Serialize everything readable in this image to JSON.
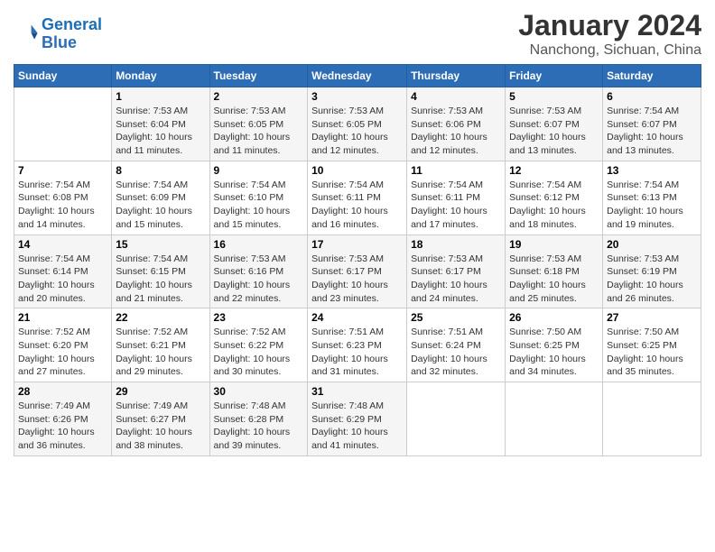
{
  "logo": {
    "line1": "General",
    "line2": "Blue"
  },
  "title": "January 2024",
  "subtitle": "Nanchong, Sichuan, China",
  "weekdays": [
    "Sunday",
    "Monday",
    "Tuesday",
    "Wednesday",
    "Thursday",
    "Friday",
    "Saturday"
  ],
  "weeks": [
    [
      {
        "day": "",
        "sunrise": "",
        "sunset": "",
        "daylight": ""
      },
      {
        "day": "1",
        "sunrise": "Sunrise: 7:53 AM",
        "sunset": "Sunset: 6:04 PM",
        "daylight": "Daylight: 10 hours and 11 minutes."
      },
      {
        "day": "2",
        "sunrise": "Sunrise: 7:53 AM",
        "sunset": "Sunset: 6:05 PM",
        "daylight": "Daylight: 10 hours and 11 minutes."
      },
      {
        "day": "3",
        "sunrise": "Sunrise: 7:53 AM",
        "sunset": "Sunset: 6:05 PM",
        "daylight": "Daylight: 10 hours and 12 minutes."
      },
      {
        "day": "4",
        "sunrise": "Sunrise: 7:53 AM",
        "sunset": "Sunset: 6:06 PM",
        "daylight": "Daylight: 10 hours and 12 minutes."
      },
      {
        "day": "5",
        "sunrise": "Sunrise: 7:53 AM",
        "sunset": "Sunset: 6:07 PM",
        "daylight": "Daylight: 10 hours and 13 minutes."
      },
      {
        "day": "6",
        "sunrise": "Sunrise: 7:54 AM",
        "sunset": "Sunset: 6:07 PM",
        "daylight": "Daylight: 10 hours and 13 minutes."
      }
    ],
    [
      {
        "day": "7",
        "sunrise": "Sunrise: 7:54 AM",
        "sunset": "Sunset: 6:08 PM",
        "daylight": "Daylight: 10 hours and 14 minutes."
      },
      {
        "day": "8",
        "sunrise": "Sunrise: 7:54 AM",
        "sunset": "Sunset: 6:09 PM",
        "daylight": "Daylight: 10 hours and 15 minutes."
      },
      {
        "day": "9",
        "sunrise": "Sunrise: 7:54 AM",
        "sunset": "Sunset: 6:10 PM",
        "daylight": "Daylight: 10 hours and 15 minutes."
      },
      {
        "day": "10",
        "sunrise": "Sunrise: 7:54 AM",
        "sunset": "Sunset: 6:11 PM",
        "daylight": "Daylight: 10 hours and 16 minutes."
      },
      {
        "day": "11",
        "sunrise": "Sunrise: 7:54 AM",
        "sunset": "Sunset: 6:11 PM",
        "daylight": "Daylight: 10 hours and 17 minutes."
      },
      {
        "day": "12",
        "sunrise": "Sunrise: 7:54 AM",
        "sunset": "Sunset: 6:12 PM",
        "daylight": "Daylight: 10 hours and 18 minutes."
      },
      {
        "day": "13",
        "sunrise": "Sunrise: 7:54 AM",
        "sunset": "Sunset: 6:13 PM",
        "daylight": "Daylight: 10 hours and 19 minutes."
      }
    ],
    [
      {
        "day": "14",
        "sunrise": "Sunrise: 7:54 AM",
        "sunset": "Sunset: 6:14 PM",
        "daylight": "Daylight: 10 hours and 20 minutes."
      },
      {
        "day": "15",
        "sunrise": "Sunrise: 7:54 AM",
        "sunset": "Sunset: 6:15 PM",
        "daylight": "Daylight: 10 hours and 21 minutes."
      },
      {
        "day": "16",
        "sunrise": "Sunrise: 7:53 AM",
        "sunset": "Sunset: 6:16 PM",
        "daylight": "Daylight: 10 hours and 22 minutes."
      },
      {
        "day": "17",
        "sunrise": "Sunrise: 7:53 AM",
        "sunset": "Sunset: 6:17 PM",
        "daylight": "Daylight: 10 hours and 23 minutes."
      },
      {
        "day": "18",
        "sunrise": "Sunrise: 7:53 AM",
        "sunset": "Sunset: 6:17 PM",
        "daylight": "Daylight: 10 hours and 24 minutes."
      },
      {
        "day": "19",
        "sunrise": "Sunrise: 7:53 AM",
        "sunset": "Sunset: 6:18 PM",
        "daylight": "Daylight: 10 hours and 25 minutes."
      },
      {
        "day": "20",
        "sunrise": "Sunrise: 7:53 AM",
        "sunset": "Sunset: 6:19 PM",
        "daylight": "Daylight: 10 hours and 26 minutes."
      }
    ],
    [
      {
        "day": "21",
        "sunrise": "Sunrise: 7:52 AM",
        "sunset": "Sunset: 6:20 PM",
        "daylight": "Daylight: 10 hours and 27 minutes."
      },
      {
        "day": "22",
        "sunrise": "Sunrise: 7:52 AM",
        "sunset": "Sunset: 6:21 PM",
        "daylight": "Daylight: 10 hours and 29 minutes."
      },
      {
        "day": "23",
        "sunrise": "Sunrise: 7:52 AM",
        "sunset": "Sunset: 6:22 PM",
        "daylight": "Daylight: 10 hours and 30 minutes."
      },
      {
        "day": "24",
        "sunrise": "Sunrise: 7:51 AM",
        "sunset": "Sunset: 6:23 PM",
        "daylight": "Daylight: 10 hours and 31 minutes."
      },
      {
        "day": "25",
        "sunrise": "Sunrise: 7:51 AM",
        "sunset": "Sunset: 6:24 PM",
        "daylight": "Daylight: 10 hours and 32 minutes."
      },
      {
        "day": "26",
        "sunrise": "Sunrise: 7:50 AM",
        "sunset": "Sunset: 6:25 PM",
        "daylight": "Daylight: 10 hours and 34 minutes."
      },
      {
        "day": "27",
        "sunrise": "Sunrise: 7:50 AM",
        "sunset": "Sunset: 6:25 PM",
        "daylight": "Daylight: 10 hours and 35 minutes."
      }
    ],
    [
      {
        "day": "28",
        "sunrise": "Sunrise: 7:49 AM",
        "sunset": "Sunset: 6:26 PM",
        "daylight": "Daylight: 10 hours and 36 minutes."
      },
      {
        "day": "29",
        "sunrise": "Sunrise: 7:49 AM",
        "sunset": "Sunset: 6:27 PM",
        "daylight": "Daylight: 10 hours and 38 minutes."
      },
      {
        "day": "30",
        "sunrise": "Sunrise: 7:48 AM",
        "sunset": "Sunset: 6:28 PM",
        "daylight": "Daylight: 10 hours and 39 minutes."
      },
      {
        "day": "31",
        "sunrise": "Sunrise: 7:48 AM",
        "sunset": "Sunset: 6:29 PM",
        "daylight": "Daylight: 10 hours and 41 minutes."
      },
      {
        "day": "",
        "sunrise": "",
        "sunset": "",
        "daylight": ""
      },
      {
        "day": "",
        "sunrise": "",
        "sunset": "",
        "daylight": ""
      },
      {
        "day": "",
        "sunrise": "",
        "sunset": "",
        "daylight": ""
      }
    ]
  ]
}
